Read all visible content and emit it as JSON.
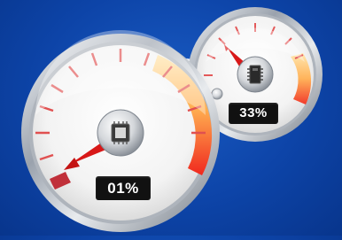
{
  "cpu_gauge": {
    "value_text": "01%",
    "percent": 1,
    "icon": "cpu-chip-icon"
  },
  "memory_gauge": {
    "value_text": "33%",
    "percent": 33,
    "icon": "memory-chip-icon"
  },
  "colors": {
    "background": "#0d44a8",
    "needle": "#d81818",
    "zone_warm": "#ffb15e",
    "zone_hot": "#f0302a",
    "bezel": "#c9ced6"
  }
}
